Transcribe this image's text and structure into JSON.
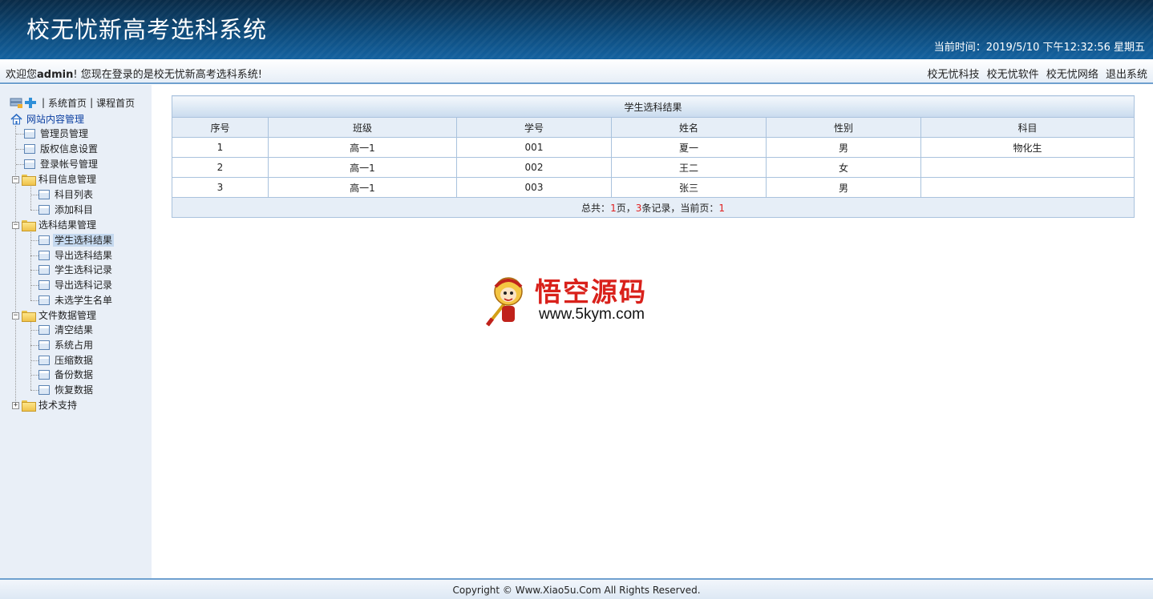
{
  "header": {
    "app_title": "校无忧新高考选科系统",
    "clock": "当前时间：2019/5/10 下午12:32:56 星期五"
  },
  "welcome_bar": {
    "prefix": "欢迎您",
    "user": "admin",
    "suffix": "! 您现在登录的是校无忧新高考选科系统!",
    "links": [
      "校无忧科技",
      "校无忧软件",
      "校无忧网络",
      "退出系统"
    ]
  },
  "sidebar": {
    "top_links": {
      "home": "系统首页",
      "course_home": "课程首页",
      "separator": "|"
    },
    "root_label": "网站内容管理",
    "items": {
      "admin_mgmt": "管理员管理",
      "copyright": "版权信息设置",
      "login_account": "登录帐号管理",
      "subject_info": "科目信息管理",
      "subject_list": "科目列表",
      "add_subject": "添加科目",
      "selection_result_mgmt": "选科结果管理",
      "student_results": "学生选科结果",
      "export_results": "导出选科结果",
      "student_records": "学生选科记录",
      "export_records": "导出选科记录",
      "unselected_list": "未选学生名单",
      "file_data_mgmt": "文件数据管理",
      "clear_results": "清空结果",
      "system_usage": "系统占用",
      "compress_data": "压缩数据",
      "backup_data": "备份数据",
      "restore_data": "恢复数据",
      "tech_support": "技术支持"
    }
  },
  "table": {
    "caption": "学生选科结果",
    "columns": [
      "序号",
      "班级",
      "学号",
      "姓名",
      "性别",
      "科目"
    ],
    "rows": [
      [
        "1",
        "高一1",
        "001",
        "夏一",
        "男",
        "物化生"
      ],
      [
        "2",
        "高一1",
        "002",
        "王二",
        "女",
        ""
      ],
      [
        "3",
        "高一1",
        "003",
        "张三",
        "男",
        ""
      ]
    ],
    "pager": {
      "t1": "总共：",
      "pages": "1",
      "t2": "页，",
      "records": "3",
      "t3": "条记录，当前页：",
      "current": "1"
    }
  },
  "watermark": {
    "brand": "悟空源码",
    "url": "www.5kym.com"
  },
  "footer": {
    "copyright": "Copyright © Www.Xiao5u.Com All Rights Reserved."
  },
  "colors": {
    "header_dark": "#0a2b47",
    "header_light": "#1462a0",
    "accent_border": "#6fa0cf",
    "pager_highlight": "#e02020",
    "watermark_red": "#d9211b"
  }
}
